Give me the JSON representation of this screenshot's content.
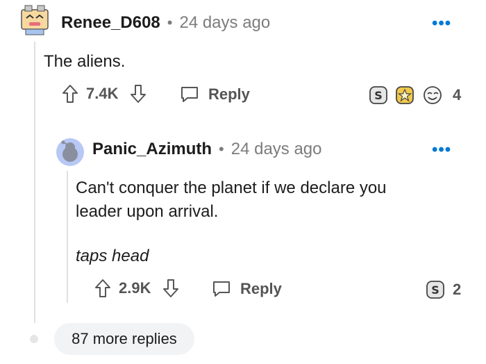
{
  "comment": {
    "username": "Renee_D608",
    "time": "24 days ago",
    "body": "The aliens.",
    "upvotes": "7.4K",
    "reply_label": "Reply",
    "award_count": "4"
  },
  "reply": {
    "username": "Panic_Azimuth",
    "time": "24 days ago",
    "body_line1": "Can't conquer the planet if we declare you",
    "body_line2": "leader upon arrival.",
    "body_italic": "taps head",
    "upvotes": "2.9K",
    "reply_label": "Reply",
    "award_count": "2"
  },
  "more_replies": "87 more replies",
  "separator": "•",
  "menu_glyph": "•••",
  "colors": {
    "accent": "#0079d3",
    "muted": "#7c7c7c",
    "line": "#e0e0e0"
  }
}
